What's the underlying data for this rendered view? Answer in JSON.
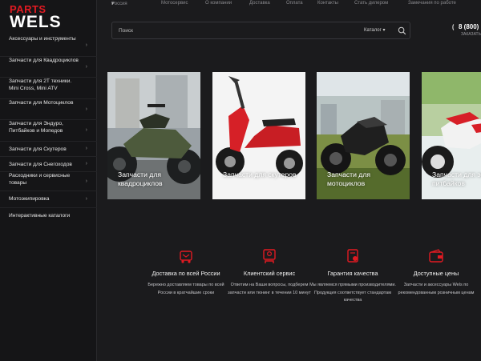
{
  "logo": {
    "line1": "PARTS",
    "line2": "WELS"
  },
  "sidebar": {
    "items": [
      {
        "label": "Аксессуары и инструменты",
        "chevron": true
      },
      {
        "label": "Запчасти для Квадроциклов",
        "chevron": true
      },
      {
        "label": "Запчасти для 2Т техники. Mini Cross, Mini ATV",
        "chevron": false
      },
      {
        "label": "Запчасти для Мотоциклов",
        "chevron": true
      },
      {
        "label": "Запчасти для Эндуро, Питбайков и Мопедов",
        "chevron": true
      },
      {
        "label": "Запчасти для Скутеров",
        "chevron": true
      },
      {
        "label": "Запчасти для Снегоходов",
        "chevron": true
      },
      {
        "label": "Расходники и сервисные товары",
        "chevron": true
      },
      {
        "label": "Мотоэкипировка",
        "chevron": true
      },
      {
        "label": "Интерактивные каталоги",
        "chevron": false
      }
    ]
  },
  "topnav": {
    "region": "Россия",
    "links": [
      "Мотосервис",
      "О компании",
      "Доставка",
      "Оплата",
      "Контакты",
      "Стать дилером",
      "Замечания по работе"
    ]
  },
  "search": {
    "placeholder": "Поиск",
    "catalog_label": "Каталог"
  },
  "contact": {
    "phone": "8 (800)",
    "callback": "ЗАКАЗАТЬ"
  },
  "cards": [
    {
      "caption": "Запчасти для квадроциклов"
    },
    {
      "caption": "Запчасти для скутеров"
    },
    {
      "caption": "Запчасти для мотоциклов"
    },
    {
      "caption": "Запчасти для эндуро и питбайков"
    }
  ],
  "features": [
    {
      "icon": "delivery-icon",
      "title": "Доставка по всей России",
      "desc": "Бережно доставляем товары по всей России в кратчайшие сроки"
    },
    {
      "icon": "support-icon",
      "title": "Клиентский сервис",
      "desc": "Ответим на Ваши вопросы, подберем запчасти или тюнинг в течении 10 минут"
    },
    {
      "icon": "quality-icon",
      "title": "Гарантия качества",
      "desc": "Мы являемся прямыми производителями. Продукция соответствует стандартам качества"
    },
    {
      "icon": "wallet-icon",
      "title": "Доступные цены",
      "desc": "Запчасти и аксессуары Wels по рекомендованным розничным ценам"
    }
  ],
  "colors": {
    "accent": "#e11a22",
    "background": "#1b1b1d",
    "sidebar": "#151517"
  }
}
